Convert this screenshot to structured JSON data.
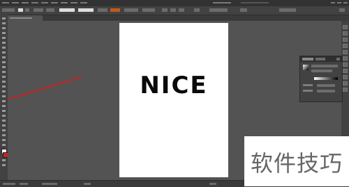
{
  "document": {
    "headline": "NICE"
  },
  "watermark": {
    "text": "软件技巧"
  },
  "colors": {
    "app_background": "#535353",
    "panel_background": "#424242",
    "menubar_background": "#323232",
    "artboard": "#ffffff",
    "headline_text": "#0a0a0a",
    "annotation_arrow": "#cc2222"
  },
  "icons": {
    "tools": [
      "selection-tool-icon",
      "direct-selection-tool-icon",
      "magic-wand-icon",
      "lasso-icon",
      "pen-tool-icon",
      "type-tool-icon",
      "line-segment-icon",
      "rectangle-tool-icon",
      "paintbrush-icon",
      "pencil-icon",
      "eraser-icon",
      "rotate-tool-icon",
      "scale-tool-icon",
      "warp-tool-icon",
      "free-transform-icon",
      "shape-builder-icon",
      "perspective-grid-icon",
      "mesh-tool-icon",
      "gradient-tool-icon",
      "eyedropper-icon",
      "blend-tool-icon",
      "symbol-sprayer-icon",
      "column-graph-icon",
      "artboard-tool-icon",
      "slice-tool-icon",
      "hand-tool-icon",
      "zoom-tool-icon"
    ],
    "panel_strip": [
      "color-panel-icon",
      "swatches-icon",
      "brushes-icon",
      "symbols-icon",
      "stroke-icon",
      "gradient-panel-icon",
      "transparency-icon",
      "appearance-icon",
      "graphic-styles-icon",
      "layers-icon",
      "artboards-icon"
    ]
  }
}
